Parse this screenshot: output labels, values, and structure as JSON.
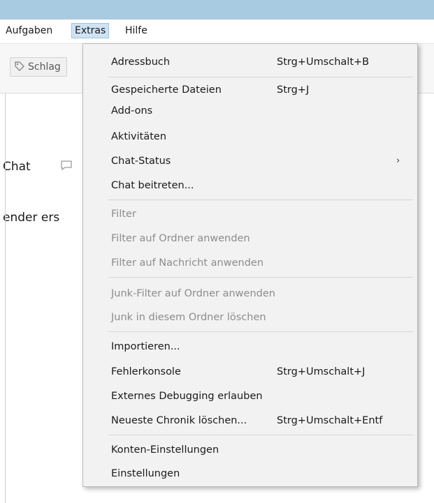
{
  "menubar": {
    "items": [
      {
        "label": "Aufgaben"
      },
      {
        "label": "Extras"
      },
      {
        "label": "Hilfe"
      }
    ]
  },
  "toolbar": {
    "tag_button": "Schlag"
  },
  "background": {
    "chat_text": "Chat",
    "sender_text": "ender ers"
  },
  "dropdown": {
    "items": [
      {
        "label": "Adressbuch",
        "shortcut": "Strg+Umschalt+B"
      },
      {
        "label": "Gespeicherte Dateien",
        "shortcut": "Strg+J"
      },
      {
        "label": "Add-ons"
      },
      {
        "label": "Aktivitäten"
      },
      {
        "label": "Chat-Status",
        "arrow": "›"
      },
      {
        "label": "Chat beitreten..."
      },
      {
        "label": "Filter"
      },
      {
        "label": "Filter auf Ordner anwenden"
      },
      {
        "label": "Filter auf Nachricht anwenden"
      },
      {
        "label": "Junk-Filter auf Ordner anwenden"
      },
      {
        "label": "Junk in diesem Ordner löschen"
      },
      {
        "label": "Importieren..."
      },
      {
        "label": "Fehlerkonsole",
        "shortcut": "Strg+Umschalt+J"
      },
      {
        "label": "Externes Debugging erlauben"
      },
      {
        "label": "Neueste Chronik löschen...",
        "shortcut": "Strg+Umschalt+Entf"
      },
      {
        "label": "Konten-Einstellungen"
      },
      {
        "label": "Einstellungen"
      }
    ]
  },
  "colors": {
    "titlebar": "#a8cbe2",
    "menu_highlight": "#cfe3f4",
    "dropdown_bg": "#f2f2f2",
    "disabled_text": "#8c8c8c"
  }
}
